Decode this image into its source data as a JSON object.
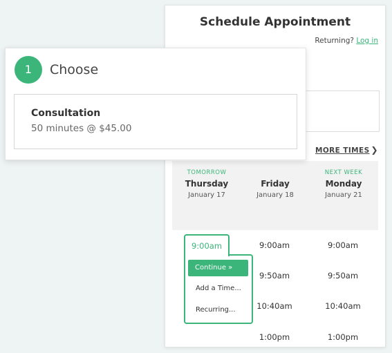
{
  "schedule": {
    "title": "Schedule Appointment",
    "returning_text": "Returning?",
    "login_link": "Log in",
    "more_times": "MORE TIMES",
    "days": [
      {
        "tag": "TOMORROW",
        "name": "Thursday",
        "date": "January 17"
      },
      {
        "tag": "",
        "name": "Friday",
        "date": "January 18"
      },
      {
        "tag": "NEXT WEEK",
        "name": "Monday",
        "date": "January 21"
      }
    ],
    "selected_slot": "9:00am",
    "menu": {
      "continue": "Continue »",
      "add_time": "Add a Time...",
      "recurring": "Recurring..."
    },
    "friday_slots": [
      "9:00am",
      "9:50am",
      "10:40am",
      "1:00pm"
    ],
    "monday_slots": [
      "9:00am",
      "9:50am",
      "10:40am",
      "1:00pm"
    ]
  },
  "choose": {
    "step_number": "1",
    "title": "Choose",
    "service_name": "Consultation",
    "service_detail": "50 minutes @ $45.00"
  },
  "colors": {
    "accent": "#3bb57a"
  }
}
